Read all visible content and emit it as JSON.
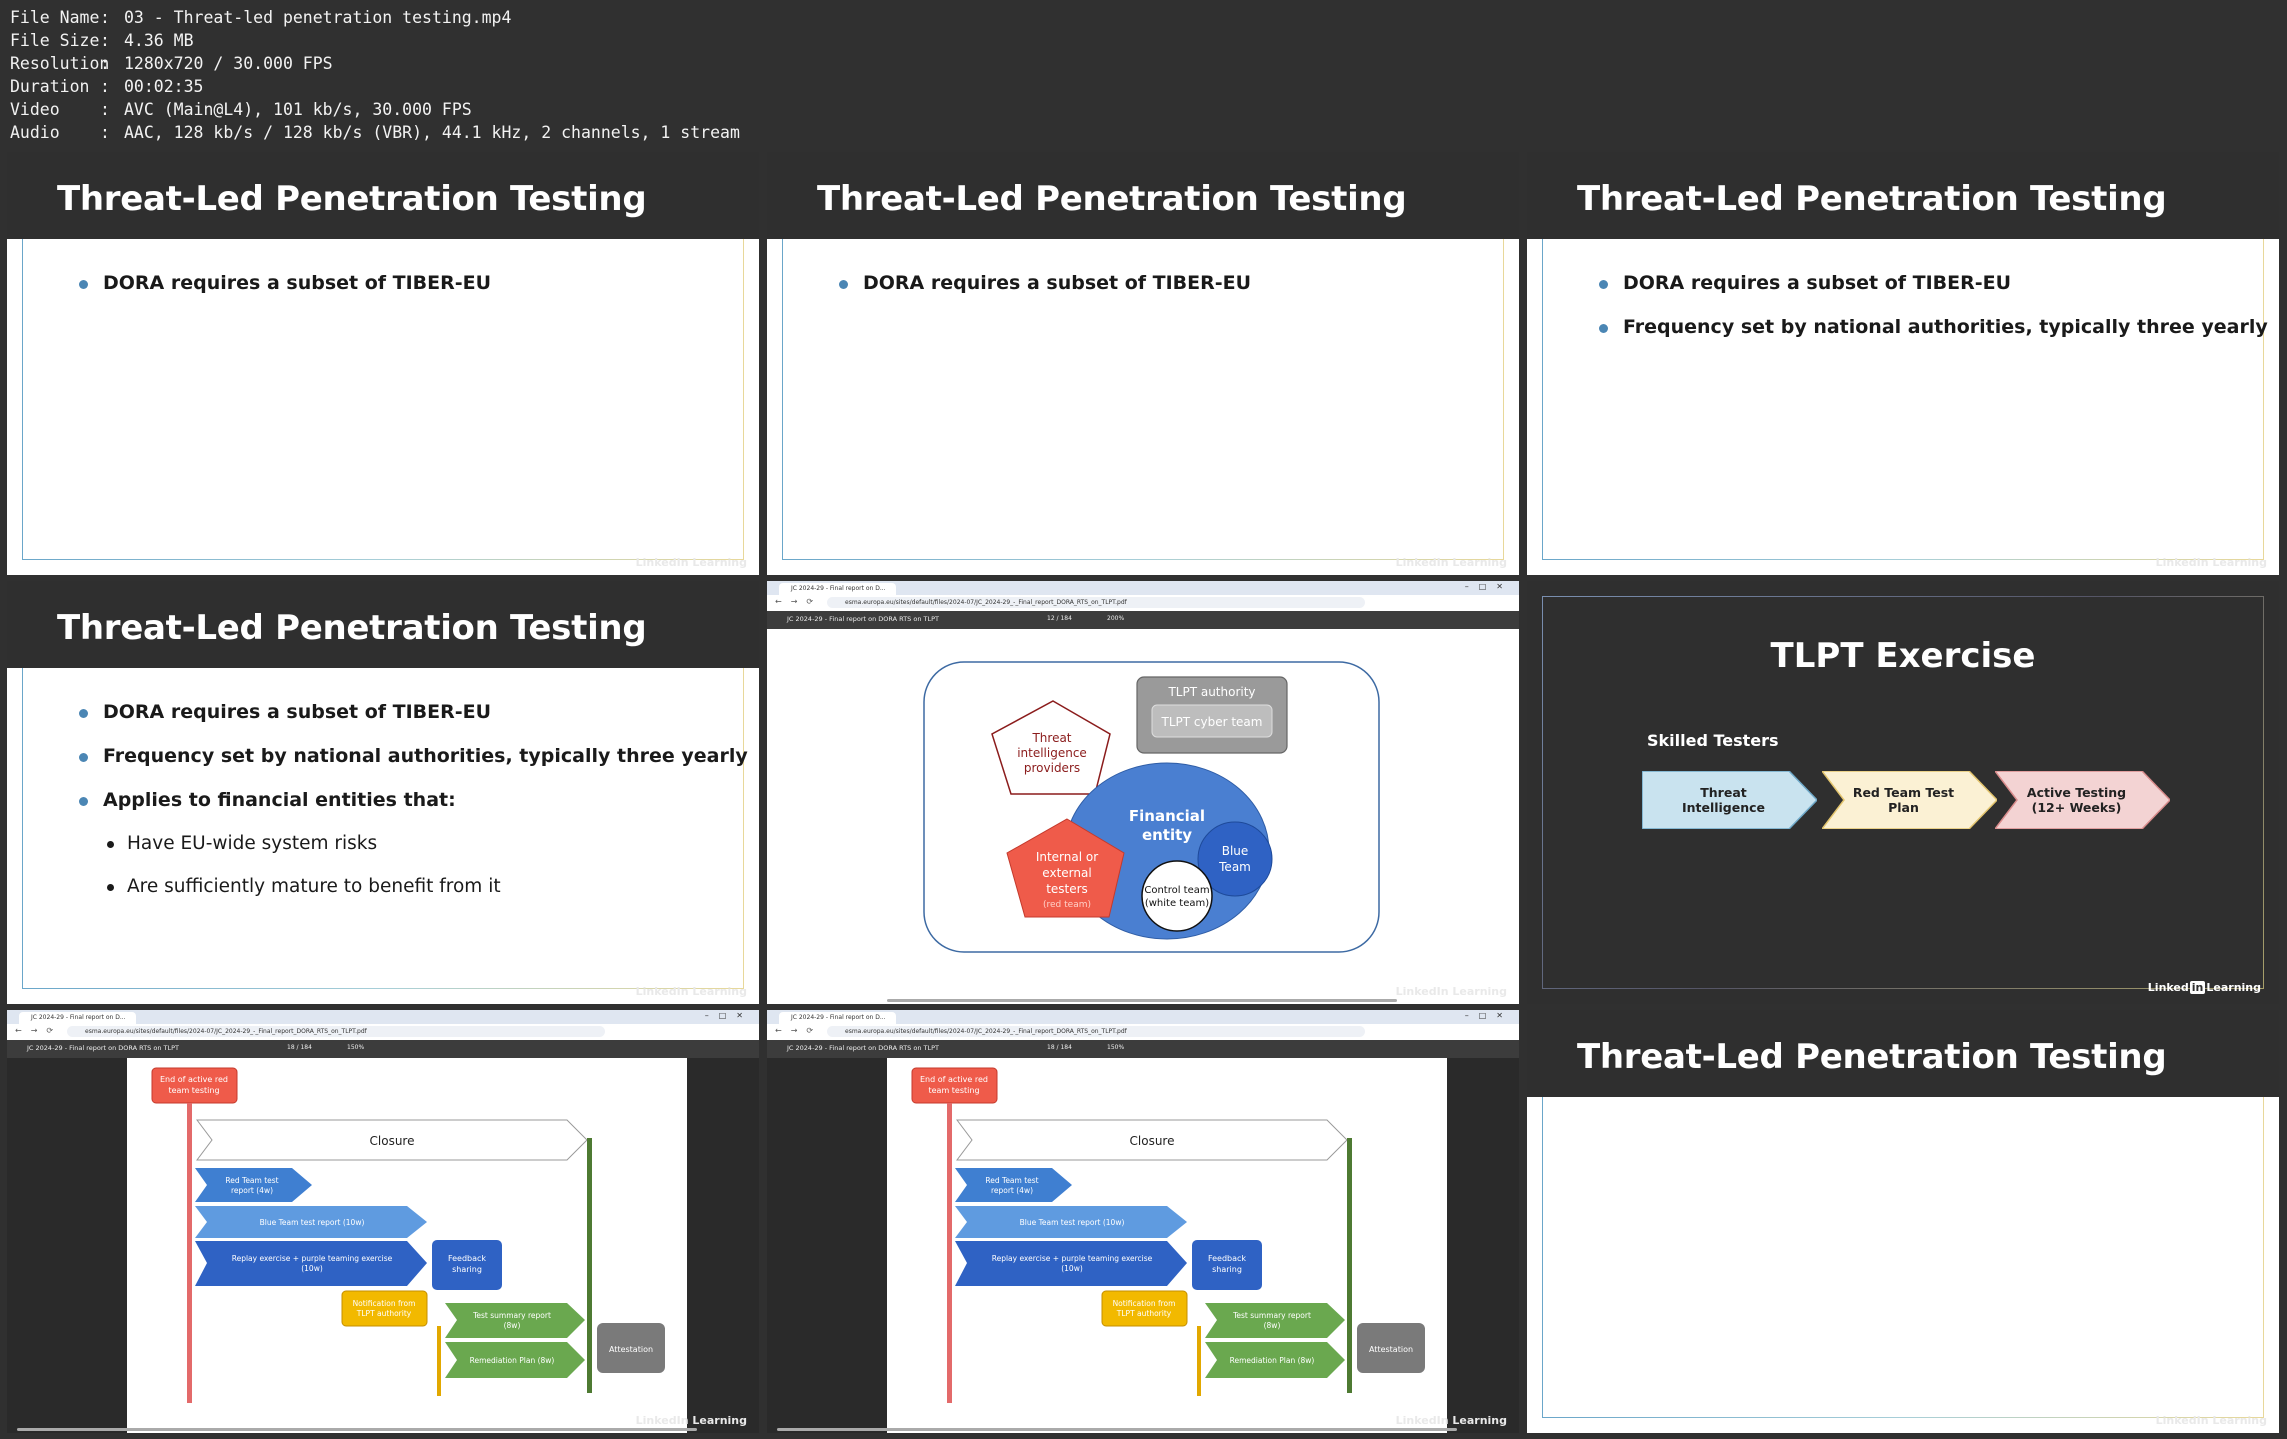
{
  "meta": [
    {
      "key": "File Name",
      "value": "03 - Threat-led penetration testing.mp4"
    },
    {
      "key": "File Size",
      "value": "4.36 MB"
    },
    {
      "key": "Resolution",
      "value": "1280x720 / 30.000 FPS"
    },
    {
      "key": "Duration",
      "value": "00:02:35"
    },
    {
      "key": "Video",
      "value": "AVC (Main@L4), 101 kb/s, 30.000 FPS"
    },
    {
      "key": "Audio",
      "value": "AAC, 128 kb/s / 128 kb/s (VBR), 44.1 kHz, 2 channels, 1 stream"
    }
  ],
  "meta_sep": ":",
  "slide_title": "Threat-Led Penetration Testing",
  "bullets": {
    "dora": "DORA requires a subset of TIBER-EU",
    "frequency": "Frequency set by national authorities, typically three yearly",
    "applies": "Applies to financial entities that:",
    "eu_risks": "Have EU-wide system risks",
    "mature": "Are sufficiently mature to benefit from it"
  },
  "watermark": "LinkedIn Learning",
  "browser": {
    "tab_title": "JC 2024-29 - Final report on D...",
    "url": "esma.europa.eu/sites/default/files/2024-07/JC_2024-29_-_Final_report_DORA_RTS_on_TLPT.pdf",
    "pdf_title": "JC 2024-29 - Final report on DORA RTS on TLPT",
    "page_a": "12 / 184",
    "zoom_a": "200%",
    "page_b": "18 / 184",
    "zoom_b": "150%"
  },
  "diagram": {
    "tlpt_authority": "TLPT authority",
    "tlpt_cyber_team": "TLPT cyber team",
    "threat_intel": [
      "Threat",
      "intelligence",
      "providers"
    ],
    "financial_entity": [
      "Financial",
      "entity"
    ],
    "blue_team": [
      "Blue",
      "Team"
    ],
    "testers": [
      "Internal or",
      "external",
      "testers"
    ],
    "red_team": "(red team)",
    "control_team": [
      "Control team",
      "(white team)"
    ]
  },
  "closure": {
    "end_active": [
      "End of active red",
      "team testing"
    ],
    "closure": "Closure",
    "red_report": [
      "Red Team test",
      "report (4w)"
    ],
    "blue_report": "Blue Team test report (10w)",
    "replay": [
      "Replay exercise + purple teaming exercise",
      "(10w)"
    ],
    "feedback": [
      "Feedback",
      "sharing"
    ],
    "notification": [
      "Notification from",
      "TLPT authority"
    ],
    "test_summary": [
      "Test summary report",
      "(8w)"
    ],
    "remediation": "Remediation Plan (8w)",
    "attestation": "Attestation"
  },
  "tlpt": {
    "title": "TLPT Exercise",
    "subtitle": "Skilled Testers",
    "steps": [
      {
        "label": "Threat Intelligence",
        "color": "#c9e3ef",
        "border": "#6fa9c9"
      },
      {
        "label": "Red Team Test Plan",
        "color": "#fbf1d4",
        "border": "#e3c56e"
      },
      {
        "label": "Active Testing (12+ Weeks)",
        "color": "#f3d3d3",
        "border": "#d98c8c"
      }
    ]
  },
  "colors": {
    "header": "#2f2f2f",
    "bullet": "#4b86b4",
    "background": "#303030"
  }
}
